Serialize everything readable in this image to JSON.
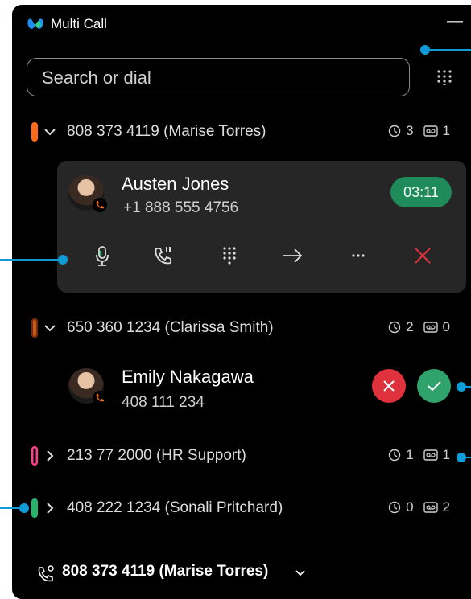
{
  "app": {
    "title": "Multi Call",
    "minimize_label": "—"
  },
  "search": {
    "placeholder": "Search or dial",
    "value": ""
  },
  "lines": [
    {
      "number": "808 373 4119 (Marise Torres)",
      "history_count": "3",
      "voicemail_count": "1",
      "pill_color": "#ff6a1a",
      "expanded": true
    },
    {
      "number": "650 360 1234 (Clarissa Smith)",
      "history_count": "2",
      "voicemail_count": "0",
      "pill_color": "#c45a1a",
      "expanded": true
    },
    {
      "number": "213 77 2000 (HR Support)",
      "history_count": "1",
      "voicemail_count": "1",
      "pill_color": "#ff3d8a",
      "expanded": false
    },
    {
      "number": "408 222 1234 (Sonali Pritchard)",
      "history_count": "0",
      "voicemail_count": "2",
      "pill_color": "#27b36a",
      "expanded": false
    }
  ],
  "active_call": {
    "name": "Austen Jones",
    "number": "+1 888 555 4756",
    "duration": "03:11",
    "timer_color": "#1f8a5a"
  },
  "incoming_call": {
    "name": "Emily Nakagawa",
    "number": "408 111 234",
    "decline_color": "#e0323d",
    "answer_color": "#2fa36b"
  },
  "call_controls": [
    "microphone-icon",
    "hold-icon",
    "keypad-icon",
    "transfer-icon",
    "more-icon",
    "end-call-icon"
  ],
  "footer": {
    "selected_line": "808 373 4119 (Marise Torres)"
  },
  "colors": {
    "accent": "#0e9bd6",
    "background": "#000000",
    "card": "#262626",
    "badge": "#ff6a1a"
  }
}
